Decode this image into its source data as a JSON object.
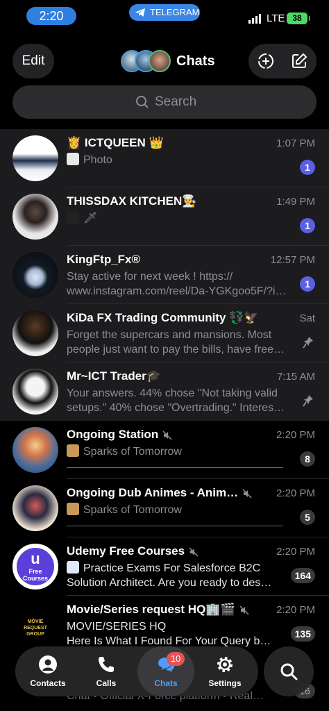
{
  "status": {
    "time": "2:20",
    "carrier_app": "TELEGRAM",
    "network": "LTE",
    "battery": "38"
  },
  "header": {
    "edit_label": "Edit",
    "title": "Chats"
  },
  "search": {
    "placeholder": "Search"
  },
  "chats": [
    {
      "name": "👸 ICTQUEEN 👑",
      "time": "1:07 PM",
      "message": "Photo",
      "badge": "1",
      "badge_style": "blue"
    },
    {
      "name": "THISSDAX KITCHEN👨‍🍳",
      "time": "1:49 PM",
      "message": "🗡",
      "badge": "1",
      "badge_style": "blue"
    },
    {
      "name": "KingFtp_Fx®",
      "time": "12:57 PM",
      "message_line1": "Stay active for next week ! https://",
      "message_line2": "www.instagram.com/reel/Da-YGKgoo5F/?i…",
      "badge": "1",
      "badge_style": "blue"
    },
    {
      "name": "KiDa FX Trading Community 💱🦅",
      "time": "Sat",
      "message_line1": "Forget the supercars and mansions. Most",
      "message_line2": "people just want to pay the bills, have free…",
      "pinned": true
    },
    {
      "name": "Mr~ICT Trader🎓",
      "time": "7:15 AM",
      "message_line1": "Your answers. 44% chose \"Not taking valid",
      "message_line2": "setups.\" 40% chose \"Overtrading.\" Interes…",
      "pinned": true
    },
    {
      "name": "Ongoing Station",
      "time": "2:20 PM",
      "message": "Sparks of Tomorrow",
      "badge": "8",
      "badge_style": "muted",
      "muted": true
    },
    {
      "name": "Ongoing Dub Animes - Anim…",
      "time": "2:20 PM",
      "message": "Sparks of Tomorrow",
      "badge": "5",
      "badge_style": "muted",
      "muted": true
    },
    {
      "name": "Udemy Free Courses",
      "time": "2:20 PM",
      "message_line1": "Practice Exams For Salesforce B2C",
      "message_line2": "Solution Architect. Are you ready to des…",
      "badge": "164",
      "badge_style": "muted",
      "muted": true,
      "avatar_text": "Free Courses"
    },
    {
      "name": "Movie/Series request HQ🏢🎬",
      "time": "2:20 PM",
      "message_line1": "MOVIE/SERIES HQ",
      "message_line2": "Here Is What I Found For Your Query b…",
      "badge": "135",
      "badge_style": "muted",
      "muted": true,
      "avatar_text": "MOVIE REQUEST GROUP"
    }
  ],
  "peek": {
    "message": "Chat • Official X-Force platform • Real…",
    "badge": "16"
  },
  "tabbar": {
    "tabs": [
      {
        "label": "Contacts",
        "icon": "person-circle-icon"
      },
      {
        "label": "Calls",
        "icon": "phone-icon"
      },
      {
        "label": "Chats",
        "icon": "chat-bubbles-icon",
        "badge": "10",
        "active": true
      },
      {
        "label": "Settings",
        "icon": "gear-icon"
      }
    ]
  },
  "colors": {
    "accent": "#4f9bff",
    "unread_badge": "#5b5fe0",
    "tab_badge": "#e55353",
    "background": "#000000"
  }
}
